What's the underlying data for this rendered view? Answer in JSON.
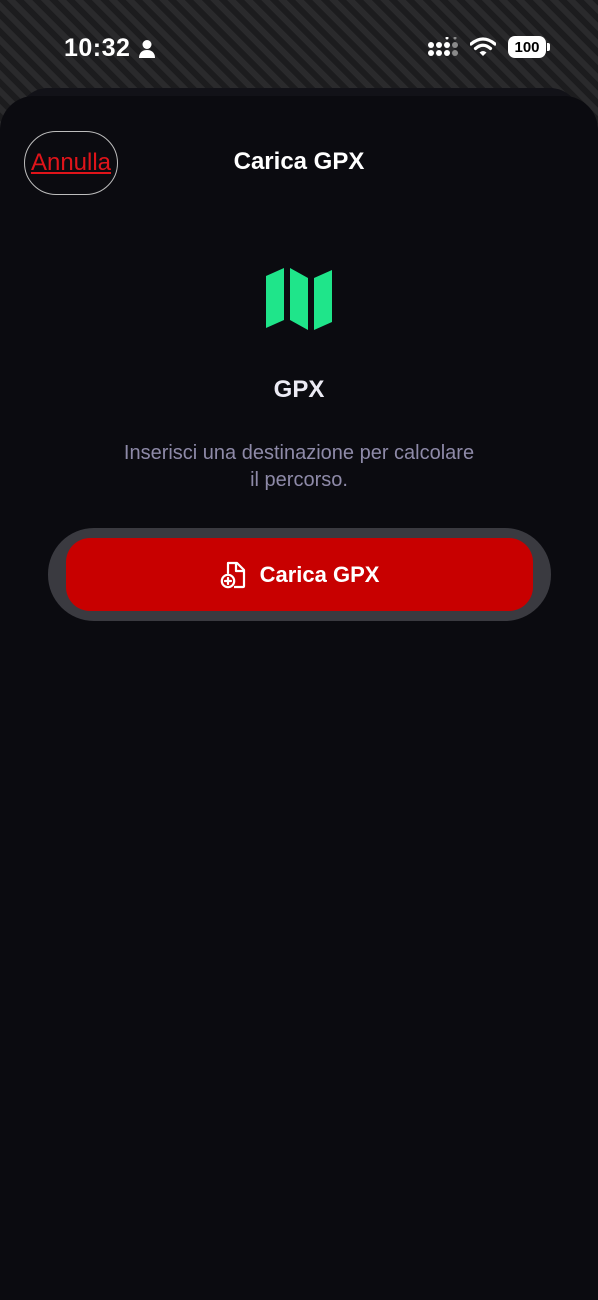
{
  "status_bar": {
    "time": "10:32",
    "battery": "100",
    "icons": [
      "person-icon",
      "signal-icon",
      "wifi-icon",
      "battery-icon"
    ]
  },
  "header": {
    "cancel_label": "Annulla",
    "title": "Carica GPX"
  },
  "content": {
    "icon": "map-icon",
    "title": "GPX",
    "description": "Inserisci una destinazione per calcolare il percorso.",
    "upload_button": {
      "label": "Carica GPX",
      "icon": "file-add-icon"
    }
  },
  "colors": {
    "accent_red": "#c80000",
    "cancel_text": "#e0141a",
    "map_icon_green": "#1fe58a",
    "sheet_background": "#0b0b10"
  }
}
